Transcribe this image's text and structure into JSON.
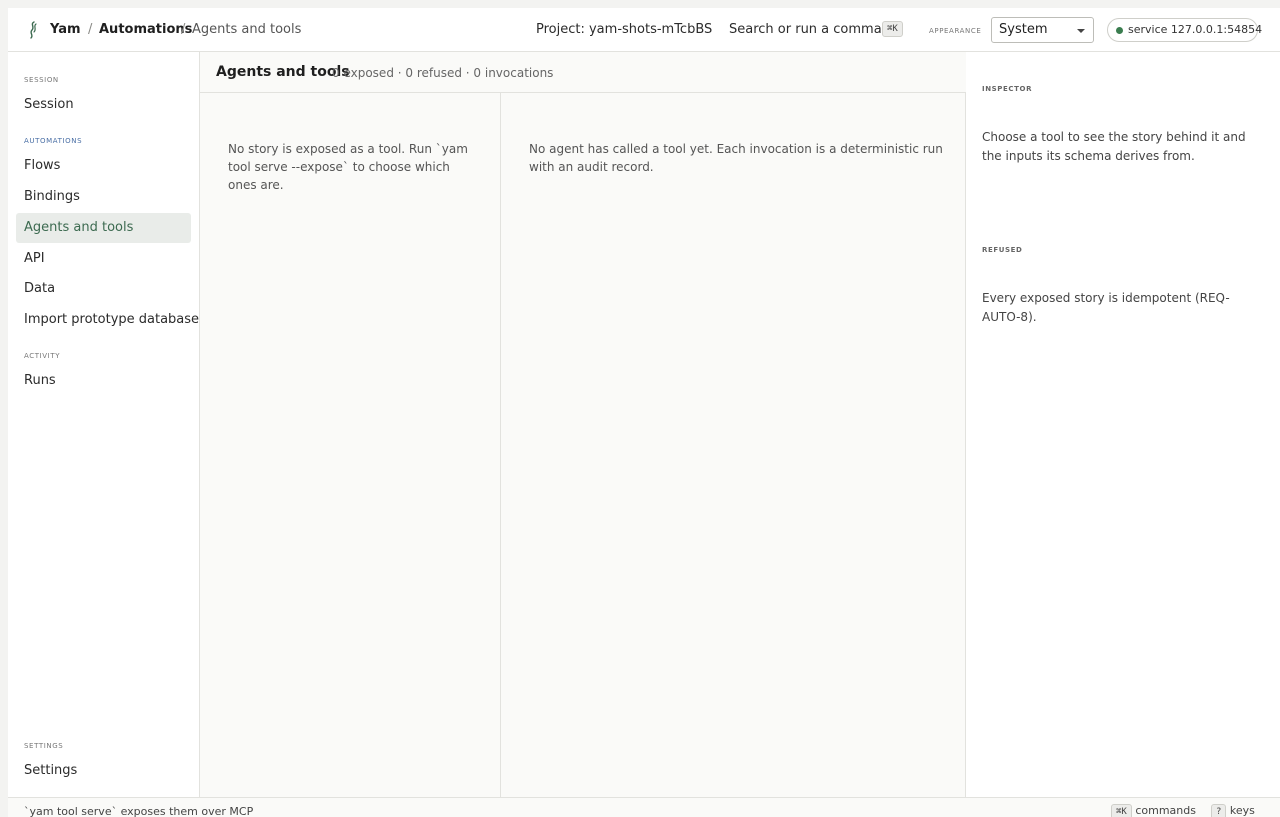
{
  "header": {
    "app_name": "Yam",
    "breadcrumb_sep": "/",
    "breadcrumb_section": "Automations",
    "breadcrumb_page": "Agents and tools",
    "project": "Project: yam-shots-mTcbBS",
    "command_label": "Search or run a command",
    "command_kbd": "⌘K",
    "appearance_label": "APPEARANCE",
    "appearance_value": "System",
    "service": "service 127.0.0.1:54854"
  },
  "sidebar": {
    "session_label": "SESSION",
    "session_item": "Session",
    "automations_label": "AUTOMATIONS",
    "automations_items": [
      "Flows",
      "Bindings",
      "Agents and tools",
      "API",
      "Data",
      "Import prototype database"
    ],
    "activity_label": "ACTIVITY",
    "activity_item": "Runs",
    "settings_label": "SETTINGS",
    "settings_item": "Settings"
  },
  "main": {
    "title": "Agents and tools",
    "stats": "0 exposed · 0 refused · 0 invocations",
    "tools_empty": "No story is exposed as a tool. Run `yam tool serve --expose` to choose which ones are.",
    "invocations_empty": "No agent has called a tool yet. Each invocation is a deterministic run with an audit record."
  },
  "inspector": {
    "inspector_label": "INSPECTOR",
    "inspector_text": "Choose a tool to see the story behind it and the inputs its schema derives from.",
    "refused_label": "REFUSED",
    "refused_text": "Every exposed story is idempotent (REQ-AUTO-8)."
  },
  "footer": {
    "hint": "`yam tool serve` exposes them over MCP",
    "commands_kbd": "⌘K",
    "commands_label": "commands",
    "keys_kbd": "?",
    "keys_label": "keys"
  },
  "colors": {
    "accent": "#3c6a50",
    "section_accent": "#4a6fa5",
    "status_dot": "#3a7d4f"
  }
}
